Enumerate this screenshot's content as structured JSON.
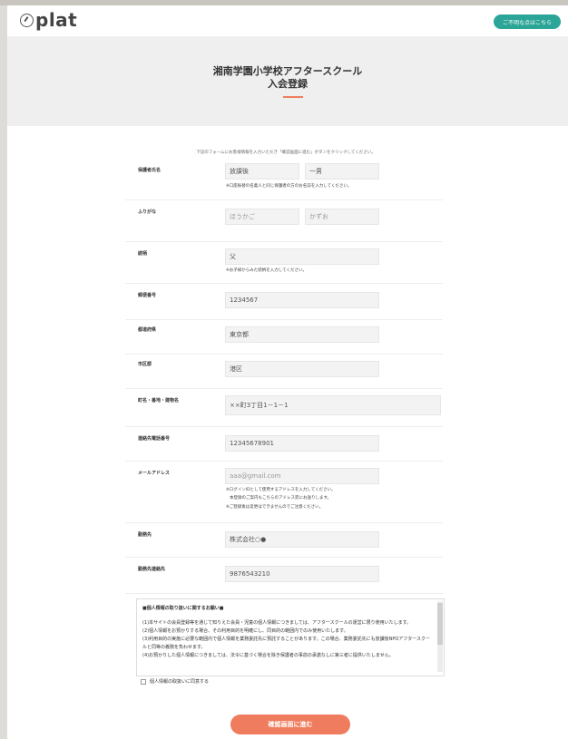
{
  "header": {
    "logo_text": "plat",
    "help_button": "ご不明な点はこちら"
  },
  "hero": {
    "title_line1": "湘南学園小学校アフタースクール",
    "title_line2": "入会登録"
  },
  "intro": "下記のフォームにお客様情報を入力いただき「確認画面に進む」ボタンをクリックしてください。",
  "form": {
    "guardian_name": {
      "label": "保護者氏名",
      "last": "放課後",
      "first": "一男",
      "note": "※口座振替の名義人と同じ保護者の方のお名前を入力してください。"
    },
    "furigana": {
      "label": "ふりがな",
      "last": "ほうかご",
      "first": "かずお"
    },
    "relationship": {
      "label": "続柄",
      "value": "父",
      "note": "※お子様からみた続柄を入力してください。"
    },
    "postal_code": {
      "label": "郵便番号",
      "value": "1234567"
    },
    "prefecture": {
      "label": "都道府県",
      "value": "東京都"
    },
    "city": {
      "label": "市区郡",
      "value": "港区"
    },
    "address": {
      "label": "町名・番地・建物名",
      "value": "××町3丁目1－1－1"
    },
    "phone": {
      "label": "連絡先電話番号",
      "value": "12345678901"
    },
    "email": {
      "label": "メールアドレス",
      "value": "aaa@gmail.com",
      "note1": "※ログインIDとして使用するアドレスを入力してください。",
      "note2": "本登録のご案内もこちらのアドレス宛にお送りします。",
      "note3": "※ご登録後は変更はできませんのでご注意ください。"
    },
    "workplace": {
      "label": "勤務先",
      "value": "株式会社○●"
    },
    "work_phone": {
      "label": "勤務先連絡先",
      "value": "9876543210"
    }
  },
  "privacy": {
    "heading": "■個人情報の取り扱いに関するお願い■",
    "p1": "(1)本サイトの会員登録等を通じて知りえた会員・児童の個人情報につきましては、アフタースクールの運営に限り使用いたします。",
    "p2": "(2)個人情報をお預かりする場合、その利用目的を明確にし、同目的の範囲内でのみ使用いたします。",
    "p3": "(3)利用目的の実施に必要な範囲内で個人情報を業務委託先に預託することがあります。この場合、業務委託先にも放課後NPOアフタースクールと同等の義務を負わせます。",
    "p4": "(4)お預かりした個人情報につきましては、法令に基づく場合を除き保護者の事前の承諾なしに第三者に提供いたしません。"
  },
  "agree_label": "個人情報の取扱いに同意する",
  "submit_label": "確認画面に進む",
  "colors": {
    "accent": "#ef7c5e",
    "help": "#2aa597"
  }
}
